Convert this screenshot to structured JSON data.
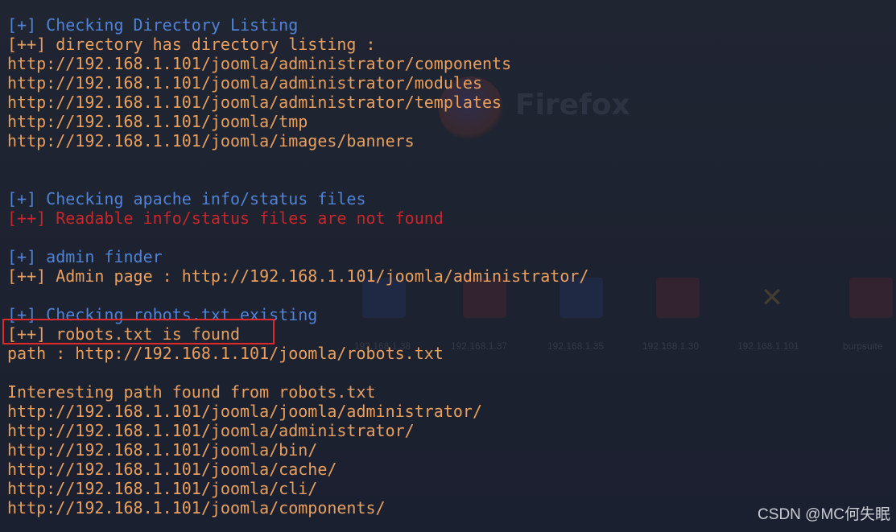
{
  "terminal": {
    "lines": [
      {
        "text": "[+] Checking Directory Listing",
        "color": "blue"
      },
      {
        "text": "[++] directory has directory listing :",
        "color": "orange"
      },
      {
        "text": "http://192.168.1.101/joomla/administrator/components",
        "color": "orange"
      },
      {
        "text": "http://192.168.1.101/joomla/administrator/modules",
        "color": "orange"
      },
      {
        "text": "http://192.168.1.101/joomla/administrator/templates",
        "color": "orange"
      },
      {
        "text": "http://192.168.1.101/joomla/tmp",
        "color": "orange"
      },
      {
        "text": "http://192.168.1.101/joomla/images/banners",
        "color": "orange"
      },
      {
        "text": "",
        "color": "orange"
      },
      {
        "text": "",
        "color": "orange"
      },
      {
        "text": "[+] Checking apache info/status files",
        "color": "blue"
      },
      {
        "text": "[++] Readable info/status files are not found",
        "color": "red"
      },
      {
        "text": "",
        "color": "orange"
      },
      {
        "text": "[+] admin finder",
        "color": "blue"
      },
      {
        "text": "[++] Admin page : http://192.168.1.101/joomla/administrator/",
        "color": "orange"
      },
      {
        "text": "",
        "color": "orange"
      },
      {
        "text": "[+] Checking robots.txt existing",
        "color": "blue"
      },
      {
        "text": "[++] robots.txt is found",
        "color": "orange"
      },
      {
        "text": "path : http://192.168.1.101/joomla/robots.txt",
        "color": "orange"
      },
      {
        "text": "",
        "color": "orange"
      },
      {
        "text": "Interesting path found from robots.txt",
        "color": "orange"
      },
      {
        "text": "http://192.168.1.101/joomla/joomla/administrator/",
        "color": "orange"
      },
      {
        "text": "http://192.168.1.101/joomla/administrator/",
        "color": "orange"
      },
      {
        "text": "http://192.168.1.101/joomla/bin/",
        "color": "orange"
      },
      {
        "text": "http://192.168.1.101/joomla/cache/",
        "color": "orange"
      },
      {
        "text": "http://192.168.1.101/joomla/cli/",
        "color": "orange"
      },
      {
        "text": "http://192.168.1.101/joomla/components/",
        "color": "orange"
      }
    ]
  },
  "background": {
    "firefox_label": "Firefox",
    "desktop_icons": [
      {
        "label": "192.168.1.38",
        "icon": "ghost-app-icon"
      },
      {
        "label": "192.168.1.37",
        "icon": "ghost-app-icon"
      },
      {
        "label": "192.168.1.35",
        "icon": "ghost-app-icon"
      },
      {
        "label": "192.168.1.30",
        "icon": "ghost-app-icon"
      },
      {
        "label": "192.168.1.101",
        "icon": "joomla-icon"
      },
      {
        "label": "burpsuite",
        "icon": "burpsuite-icon"
      }
    ]
  },
  "watermark": "CSDN @MC何失眠",
  "colors": {
    "blue": "#4f83d8",
    "orange": "#e9a05e",
    "red": "#c8262a",
    "highlight_border": "#e02a2a"
  }
}
